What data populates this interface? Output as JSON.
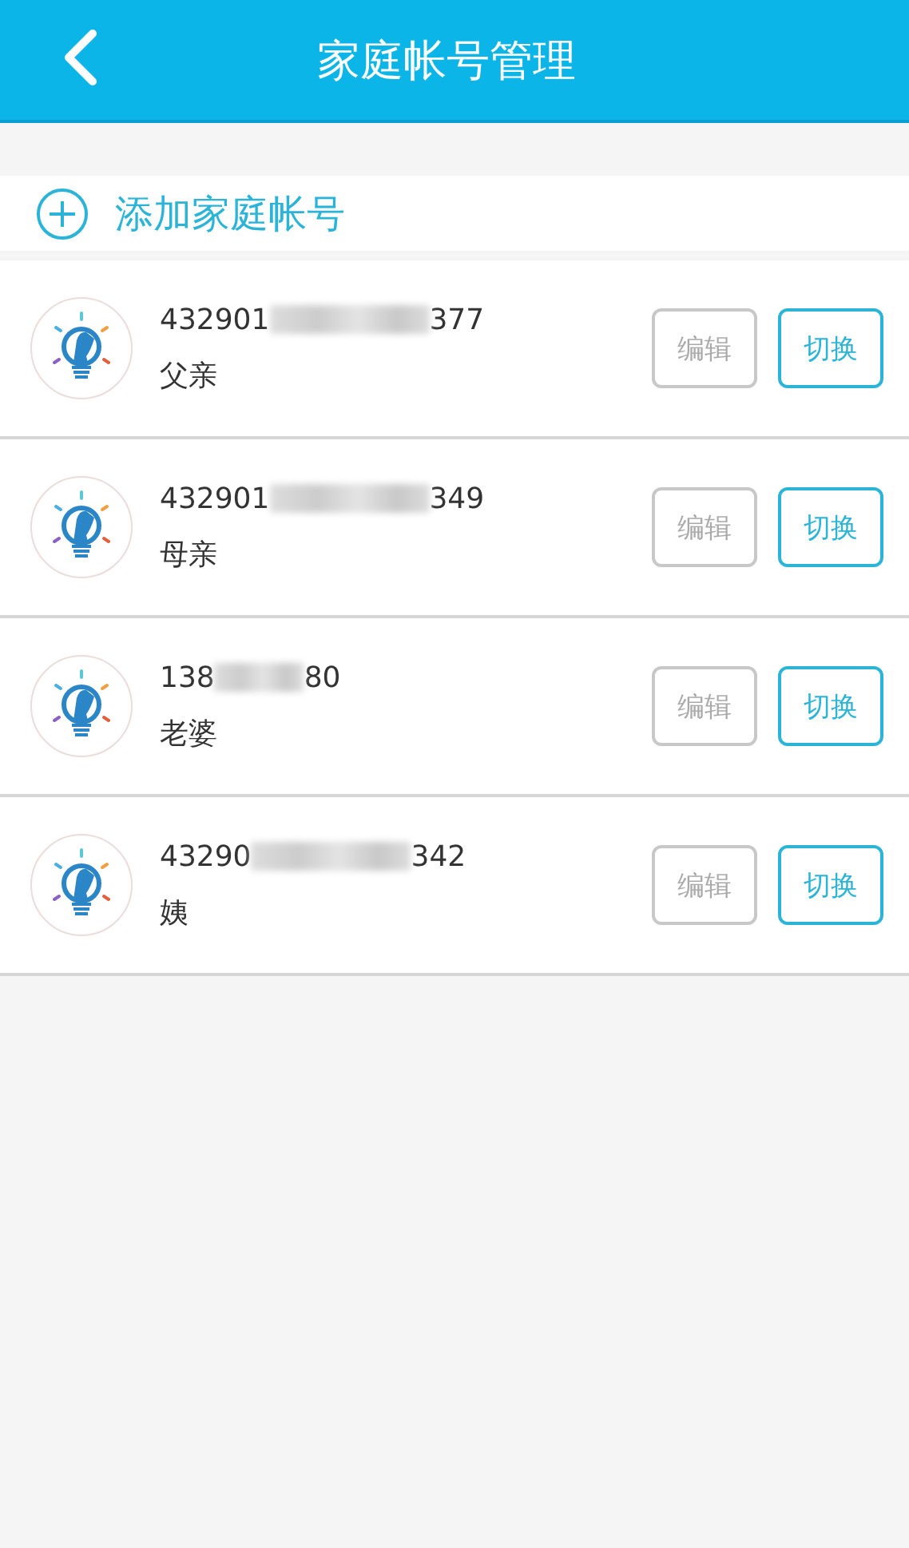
{
  "header": {
    "title": "家庭帐号管理"
  },
  "add_account": {
    "label": "添加家庭帐号"
  },
  "accounts": [
    {
      "number_prefix": "432901",
      "number_suffix": "377",
      "relation": "父亲",
      "edit_label": "编辑",
      "switch_label": "切换"
    },
    {
      "number_prefix": "432901",
      "number_suffix": "349",
      "relation": "母亲",
      "edit_label": "编辑",
      "switch_label": "切换"
    },
    {
      "number_prefix": "138",
      "number_suffix": "80",
      "relation": "老婆",
      "edit_label": "编辑",
      "switch_label": "切换"
    },
    {
      "number_prefix": "43290",
      "number_suffix": "342",
      "relation": "姨",
      "edit_label": "编辑",
      "switch_label": "切换"
    }
  ]
}
